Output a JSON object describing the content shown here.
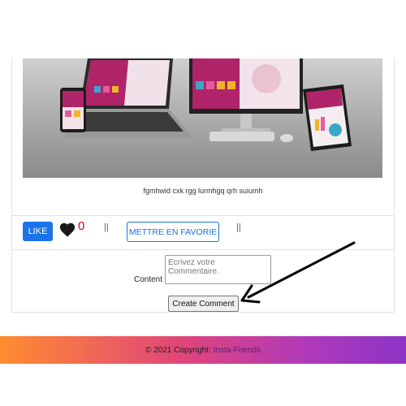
{
  "post": {
    "caption": "fgmhwid cxk rgg lurmhgq qrh suiumh"
  },
  "actions": {
    "like_label": "LIKE",
    "like_count": "0",
    "separator_1": "||",
    "favorite_label": "METTRE EN FAVORIE",
    "separator_2": "||"
  },
  "comment_form": {
    "content_label": "Content",
    "placeholder": "Ecrivez votre Commentaire.",
    "submit_label": "Create Comment"
  },
  "footer": {
    "copyright": "© 2021 Copyright:",
    "link_text": "Insta-Friends"
  },
  "colors": {
    "primary": "#1a73e8",
    "like_count": "#d0021b",
    "footer_gradient_start": "#ff8c2f",
    "footer_gradient_end": "#8e33c6"
  }
}
